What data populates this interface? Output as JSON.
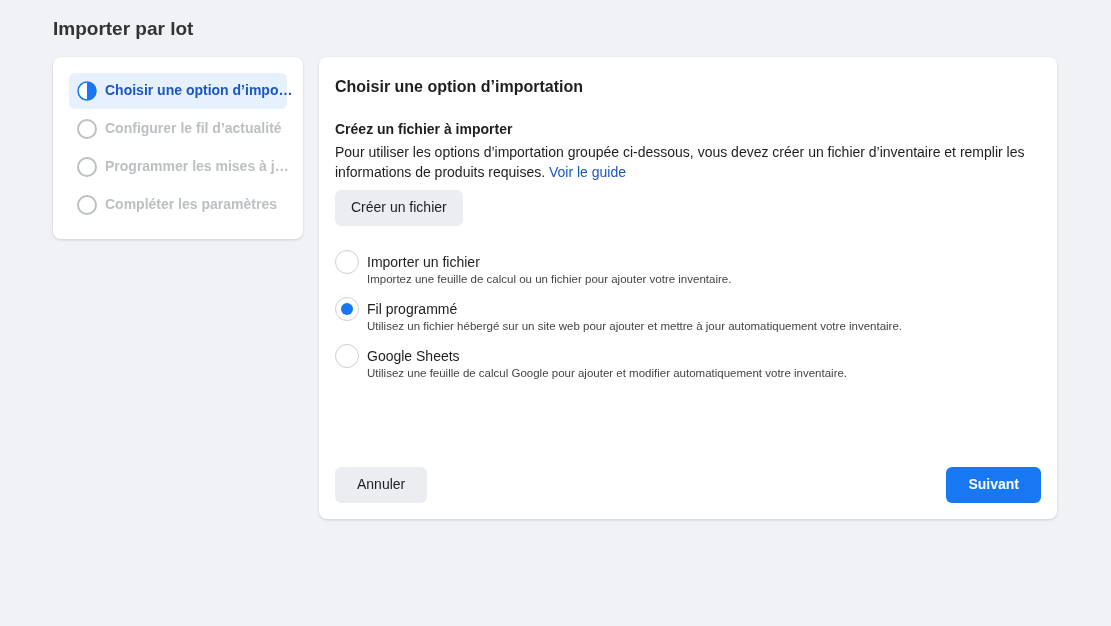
{
  "page_title": "Importer par lot",
  "steps": [
    {
      "label": "Choisir une option d’impo…",
      "selected": true
    },
    {
      "label": "Configurer le fil d’actualité",
      "selected": false
    },
    {
      "label": "Programmer les mises à j…",
      "selected": false
    },
    {
      "label": "Compléter les paramètres",
      "selected": false
    }
  ],
  "panel": {
    "title": "Choisir une option d’importation",
    "subtitle": "Créez un fichier à importer",
    "description": "Pour utiliser les options d’importation groupée ci-dessous, vous devez créer un fichier d’inventaire et remplir les informations de produits requises.",
    "link": "Voir le guide",
    "create_button": "Créer un fichier",
    "options": [
      {
        "label": "Importer un fichier",
        "description": "Importez une feuille de calcul ou un fichier pour ajouter votre inventaire.",
        "selected": false
      },
      {
        "label": "Fil programmé",
        "description": "Utilisez un fichier hébergé sur un site web pour ajouter et mettre à jour automatiquement votre inventaire.",
        "selected": true
      },
      {
        "label": "Google Sheets",
        "description": "Utilisez une feuille de calcul Google pour ajouter et modifier automatiquement votre inventaire.",
        "selected": false
      }
    ],
    "cancel_button": "Annuler",
    "next_button": "Suivant"
  }
}
